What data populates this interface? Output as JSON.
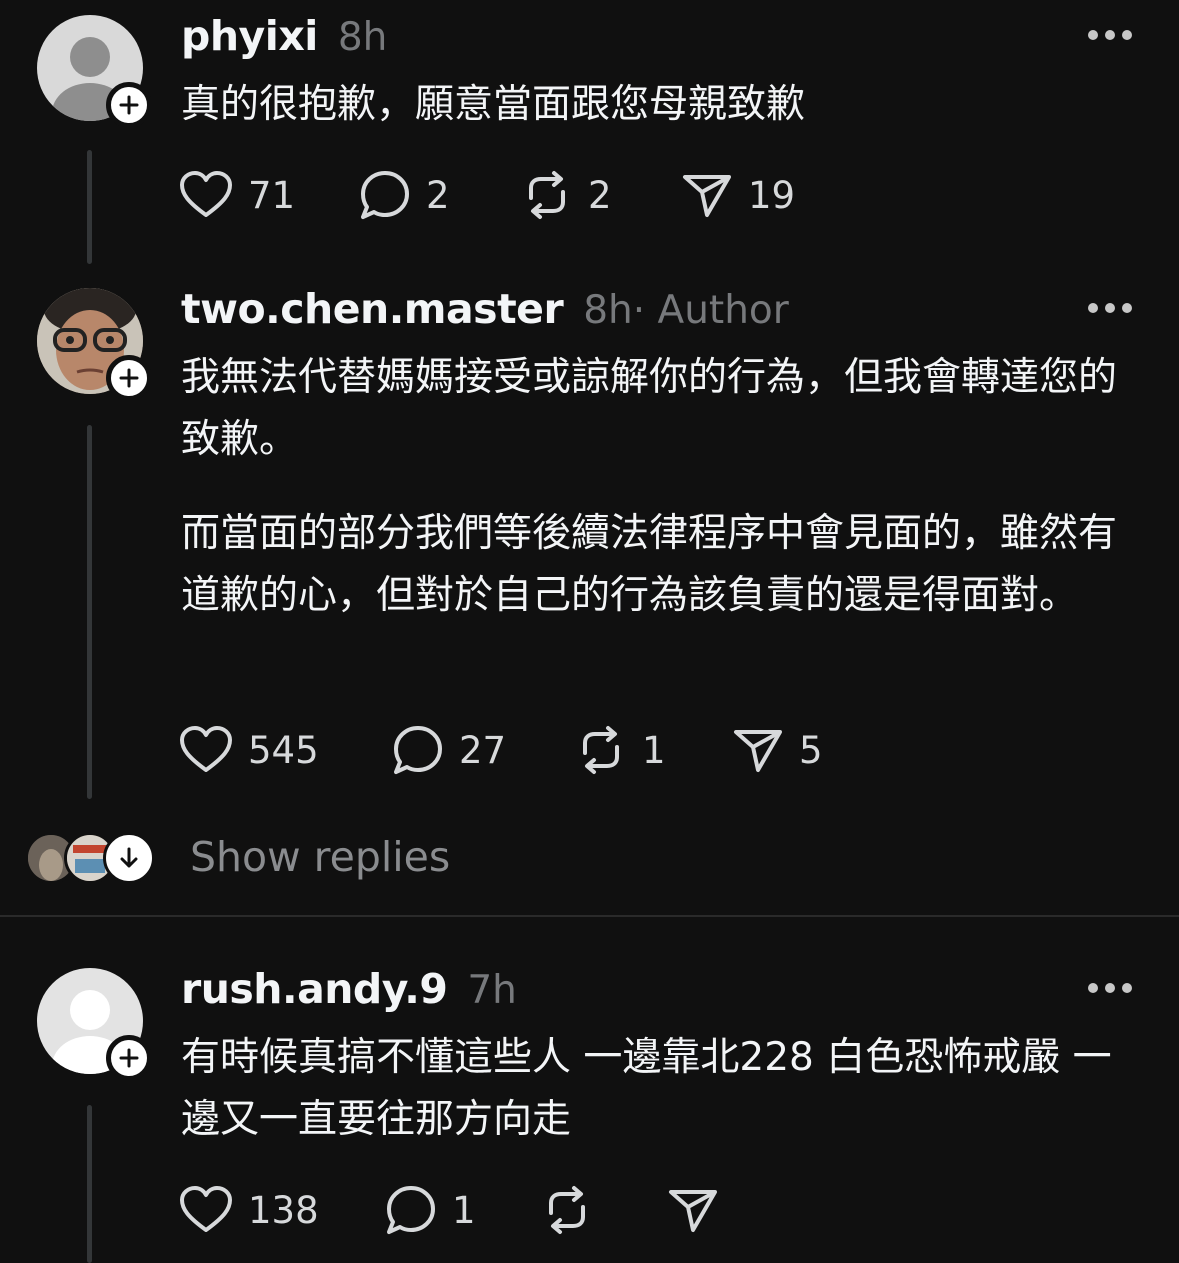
{
  "posts": [
    {
      "username": "phyixi",
      "time": "8h",
      "author_tag": "",
      "text": [
        "真的很抱歉，願意當面跟您母親致歉"
      ],
      "likes": "71",
      "replies": "2",
      "reposts": "2",
      "shares": "19"
    },
    {
      "username": "two.chen.master",
      "time": "8h",
      "author_tag": " · Author",
      "text": [
        "我無法代替媽媽接受或諒解你的行為，但我會轉達您的致歉。",
        "而當面的部分我們等後續法律程序中會見面的，雖然有道歉的心，但對於自己的行為該負責的還是得面對。"
      ],
      "likes": "545",
      "replies": "27",
      "reposts": "1",
      "shares": "5"
    },
    {
      "username": "rush.andy.9",
      "time": "7h",
      "author_tag": "",
      "text": [
        "有時候真搞不懂這些人 一邊靠北228 白色恐怖戒嚴 一邊又一直要往那方向走"
      ],
      "likes": "138",
      "replies": "1",
      "reposts": "",
      "shares": ""
    }
  ],
  "show_replies": {
    "label": "Show replies"
  },
  "icons": {
    "like": "heart-icon",
    "reply": "comment-icon",
    "repost": "repost-icon",
    "share": "send-icon",
    "more": "more-icon",
    "follow": "plus-icon",
    "expand": "arrow-down-icon"
  },
  "colors": {
    "background": "#101010",
    "text": "#f3f5f7",
    "muted": "#77797c"
  }
}
